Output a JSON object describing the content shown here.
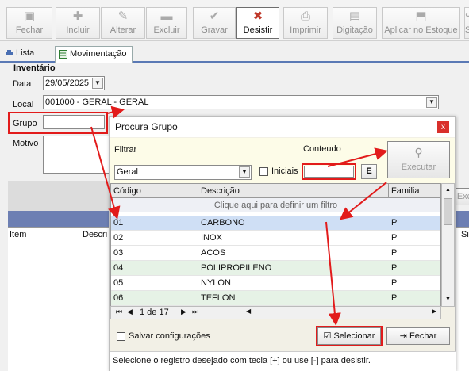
{
  "toolbar": {
    "fechar": "Fechar",
    "incluir": "Incluir",
    "alterar": "Alterar",
    "excluir": "Excluir",
    "gravar": "Gravar",
    "desistir": "Desistir",
    "imprimir": "Imprimir",
    "digitacao": "Digitação",
    "aplicar": "Aplicar no Estoque",
    "sair": "Sa"
  },
  "tabs": {
    "lista": "Lista",
    "movimentacao": "Movimentação"
  },
  "form": {
    "section": "Inventário",
    "data_label": "Data",
    "data_value": "29/05/2025",
    "local_label": "Local",
    "local_value": "001000 - GERAL - GERAL",
    "grupo_label": "Grupo",
    "grupo_value": "",
    "motivo_label": "Motivo"
  },
  "background_grid": {
    "col_item": "Item",
    "col_descr": "Descri",
    "col_sis": "Sis",
    "btn_exc": "Exc"
  },
  "modal": {
    "title": "Procura Grupo",
    "close": "x",
    "filtrar_label": "Filtrar",
    "filtrar_value": "Geral",
    "iniciais_label": "Iniciais",
    "conteudo_label": "Conteudo",
    "conteudo_value": "",
    "e_button": "E",
    "executar": "Executar",
    "columns": {
      "codigo": "Código",
      "descricao": "Descrição",
      "familia": "Familia"
    },
    "filter_row": "Clique aqui para definir um filtro",
    "rows": [
      {
        "codigo": "01",
        "descricao": "CARBONO",
        "familia": "P"
      },
      {
        "codigo": "02",
        "descricao": "INOX",
        "familia": "P"
      },
      {
        "codigo": "03",
        "descricao": "ACOS",
        "familia": "P"
      },
      {
        "codigo": "04",
        "descricao": "POLIPROPILENO",
        "familia": "P"
      },
      {
        "codigo": "05",
        "descricao": "NYLON",
        "familia": "P"
      },
      {
        "codigo": "06",
        "descricao": "TEFLON",
        "familia": "P"
      }
    ],
    "pager": "1 de 17",
    "salvar_config": "Salvar configurações",
    "selecionar": "Selecionar",
    "fechar": "Fechar",
    "status": "Selecione o registro desejado com tecla [+] ou use [-] para desistir."
  },
  "colors": {
    "highlight": "#e21b1b",
    "selected_row": "#cfdff5",
    "alt_row": "#e6f2e6",
    "tab_accent": "#5a79b5"
  }
}
